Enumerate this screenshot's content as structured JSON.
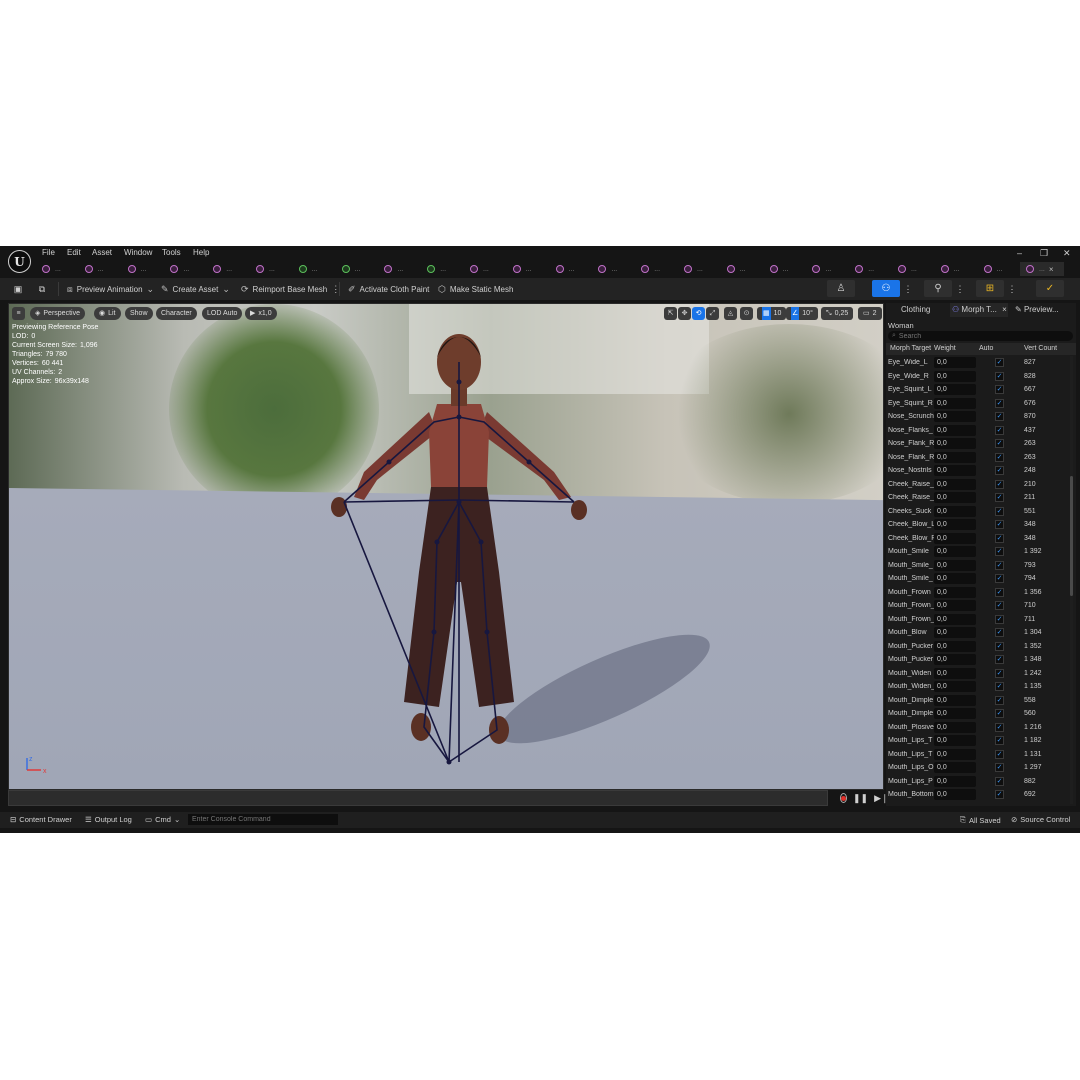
{
  "menu": [
    "File",
    "Edit",
    "Asset",
    "Window",
    "Tools",
    "Help"
  ],
  "tabs": {
    "items": [
      {
        "icon": "skeletal-mesh-icon",
        "dots": "..."
      },
      {
        "icon": "skeletal-mesh-icon",
        "dots": "..."
      },
      {
        "icon": "skeletal-mesh-icon",
        "dots": "..."
      },
      {
        "icon": "skeletal-mesh-icon",
        "dots": "..."
      },
      {
        "icon": "skeletal-mesh-icon",
        "dots": "..."
      },
      {
        "icon": "skeletal-mesh-icon",
        "dots": "..."
      },
      {
        "icon": "physics-asset-icon",
        "dots": "..."
      },
      {
        "icon": "physics-asset-icon",
        "dots": "..."
      },
      {
        "icon": "skeletal-mesh-icon",
        "dots": "..."
      },
      {
        "icon": "physics-asset-icon",
        "dots": "..."
      },
      {
        "icon": "skeletal-mesh-icon",
        "dots": "..."
      },
      {
        "icon": "skeletal-mesh-icon",
        "dots": "..."
      },
      {
        "icon": "skeletal-mesh-icon",
        "dots": "..."
      },
      {
        "icon": "skeletal-mesh-icon",
        "dots": "..."
      },
      {
        "icon": "skeletal-mesh-icon",
        "dots": "..."
      },
      {
        "icon": "skeletal-mesh-icon",
        "dots": "..."
      },
      {
        "icon": "skeletal-mesh-icon",
        "dots": "..."
      },
      {
        "icon": "skeletal-mesh-icon",
        "dots": "..."
      },
      {
        "icon": "skeletal-mesh-icon",
        "dots": "..."
      },
      {
        "icon": "skeletal-mesh-icon",
        "dots": "..."
      },
      {
        "icon": "skeletal-mesh-icon",
        "dots": "..."
      },
      {
        "icon": "skeletal-mesh-icon",
        "dots": "..."
      },
      {
        "icon": "skeletal-mesh-icon",
        "dots": "..."
      }
    ],
    "active": {
      "dots": "...",
      "close": "×"
    }
  },
  "toolbar": {
    "preview_animation": "Preview Animation",
    "create_asset": "Create Asset",
    "reimport_base_mesh": "Reimport Base Mesh",
    "activate_cloth_paint": "Activate Cloth Paint",
    "make_static_mesh": "Make Static Mesh",
    "more": "⋮"
  },
  "viewport": {
    "perspective": "Perspective",
    "lit": "Lit",
    "show": "Show",
    "character": "Character",
    "lod": "LOD Auto",
    "speed": "x1,0",
    "grid_size": "10",
    "rot_snap": "10°",
    "scale_snap": "0,25",
    "camera_speed": "2",
    "stats": [
      {
        "label": "Previewing Reference Pose",
        "value": ""
      },
      {
        "label": "LOD:",
        "value": "0"
      },
      {
        "label": "Current Screen Size:",
        "value": "1,096"
      },
      {
        "label": "Triangles:",
        "value": "79 780"
      },
      {
        "label": "Vertices:",
        "value": "60 441"
      },
      {
        "label": "UV Channels:",
        "value": "2"
      },
      {
        "label": "Approx Size:",
        "value": "96x39x148"
      }
    ],
    "axis": {
      "z": "z",
      "x": "x"
    }
  },
  "panel": {
    "tabs": [
      "Clothing",
      "Morph T...",
      "Preview..."
    ],
    "tab_close": "×",
    "mesh_name": "Woman",
    "search_placeholder": "Search",
    "columns": [
      "Morph Target",
      "Weight",
      "Auto",
      "Vert Count"
    ],
    "rows": [
      {
        "name": "Eye_Wide_L",
        "weight": "0,0",
        "auto": true,
        "verts": "827"
      },
      {
        "name": "Eye_Wide_R",
        "weight": "0,0",
        "auto": true,
        "verts": "828"
      },
      {
        "name": "Eye_Squint_L",
        "weight": "0,0",
        "auto": true,
        "verts": "667"
      },
      {
        "name": "Eye_Squint_R",
        "weight": "0,0",
        "auto": true,
        "verts": "676"
      },
      {
        "name": "Nose_Scrunch",
        "weight": "0,0",
        "auto": true,
        "verts": "870"
      },
      {
        "name": "Nose_Flanks_",
        "weight": "0,0",
        "auto": true,
        "verts": "437"
      },
      {
        "name": "Nose_Flank_R",
        "weight": "0,0",
        "auto": true,
        "verts": "263"
      },
      {
        "name": "Nose_Flank_R",
        "weight": "0,0",
        "auto": true,
        "verts": "263"
      },
      {
        "name": "Nose_Nostrils",
        "weight": "0,0",
        "auto": true,
        "verts": "248"
      },
      {
        "name": "Cheek_Raise_",
        "weight": "0,0",
        "auto": true,
        "verts": "210"
      },
      {
        "name": "Cheek_Raise_",
        "weight": "0,0",
        "auto": true,
        "verts": "211"
      },
      {
        "name": "Cheeks_Suck",
        "weight": "0,0",
        "auto": true,
        "verts": "551"
      },
      {
        "name": "Cheek_Blow_L",
        "weight": "0,0",
        "auto": true,
        "verts": "348"
      },
      {
        "name": "Cheek_Blow_R",
        "weight": "0,0",
        "auto": true,
        "verts": "348"
      },
      {
        "name": "Mouth_Smile",
        "weight": "0,0",
        "auto": true,
        "verts": "1 392"
      },
      {
        "name": "Mouth_Smile_",
        "weight": "0,0",
        "auto": true,
        "verts": "793"
      },
      {
        "name": "Mouth_Smile_",
        "weight": "0,0",
        "auto": true,
        "verts": "794"
      },
      {
        "name": "Mouth_Frown",
        "weight": "0,0",
        "auto": true,
        "verts": "1 356"
      },
      {
        "name": "Mouth_Frown_",
        "weight": "0,0",
        "auto": true,
        "verts": "710"
      },
      {
        "name": "Mouth_Frown_",
        "weight": "0,0",
        "auto": true,
        "verts": "711"
      },
      {
        "name": "Mouth_Blow",
        "weight": "0,0",
        "auto": true,
        "verts": "1 304"
      },
      {
        "name": "Mouth_Pucker",
        "weight": "0,0",
        "auto": true,
        "verts": "1 352"
      },
      {
        "name": "Mouth_Pucker",
        "weight": "0,0",
        "auto": true,
        "verts": "1 348"
      },
      {
        "name": "Mouth_Widen",
        "weight": "0,0",
        "auto": true,
        "verts": "1 242"
      },
      {
        "name": "Mouth_Widen_",
        "weight": "0,0",
        "auto": true,
        "verts": "1 135"
      },
      {
        "name": "Mouth_Dimple",
        "weight": "0,0",
        "auto": true,
        "verts": "558"
      },
      {
        "name": "Mouth_Dimple",
        "weight": "0,0",
        "auto": true,
        "verts": "560"
      },
      {
        "name": "Mouth_Plosive",
        "weight": "0,0",
        "auto": true,
        "verts": "1 216"
      },
      {
        "name": "Mouth_Lips_T",
        "weight": "0,0",
        "auto": true,
        "verts": "1 182"
      },
      {
        "name": "Mouth_Lips_T",
        "weight": "0,0",
        "auto": true,
        "verts": "1 131"
      },
      {
        "name": "Mouth_Lips_O",
        "weight": "0,0",
        "auto": true,
        "verts": "1 297"
      },
      {
        "name": "Mouth_Lips_P",
        "weight": "0,0",
        "auto": true,
        "verts": "882"
      },
      {
        "name": "Mouth_Bottom",
        "weight": "0,0",
        "auto": true,
        "verts": "692"
      }
    ]
  },
  "statusbar": {
    "content_drawer": "Content Drawer",
    "output_log": "Output Log",
    "cmd": "Cmd",
    "console_placeholder": "Enter Console Command",
    "all_saved": "All Saved",
    "source_control": "Source Control"
  },
  "colors": {
    "accent": "#1a74e8",
    "check": "#3b93f0",
    "record": "#e0302a",
    "skeleton": "#17173f"
  }
}
